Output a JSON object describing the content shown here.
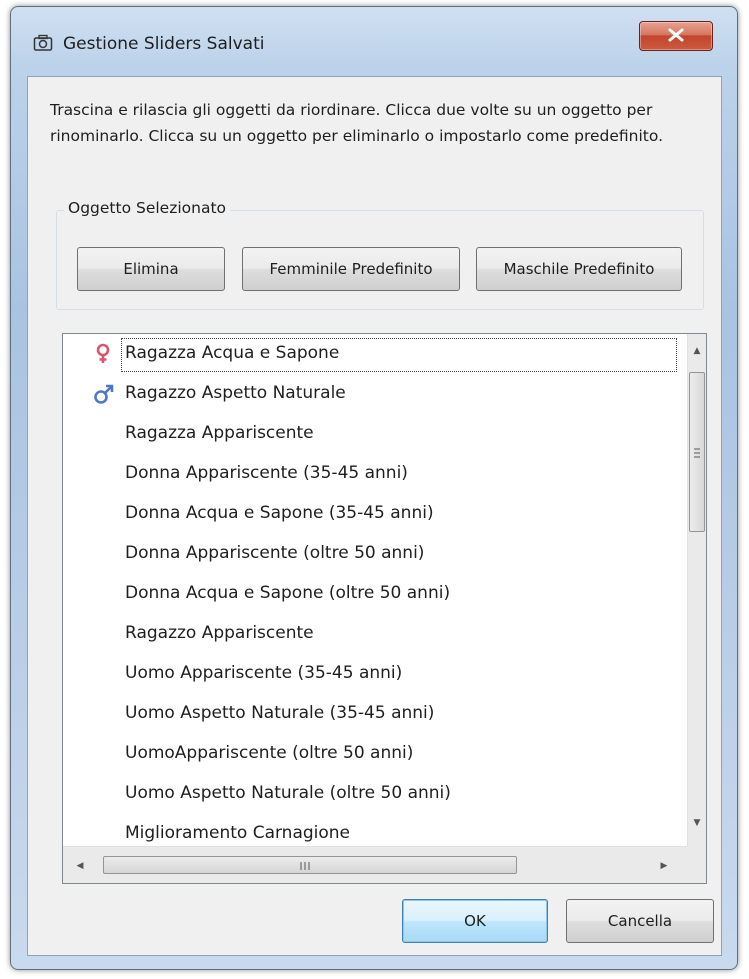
{
  "window": {
    "title": "Gestione Sliders Salvati",
    "title_icon": "camera-icon",
    "close_icon": "close-icon"
  },
  "instructions": "Trascina e rilascia gli oggetti da riordinare. Clicca due volte su un oggetto per rinominarlo. Clicca su un oggetto per eliminarlo o impostarlo come predefinito.",
  "group": {
    "legend": "Oggetto Selezionato",
    "buttons": {
      "delete": "Elimina",
      "female_default": "Femminile Predefinito",
      "male_default": "Maschile Predefinito"
    }
  },
  "list": {
    "items": [
      {
        "label": "Ragazza Acqua e Sapone",
        "icon": "female-icon"
      },
      {
        "label": "Ragazzo Aspetto Naturale",
        "icon": "male-icon"
      },
      {
        "label": "Ragazza Appariscente"
      },
      {
        "label": "Donna Appariscente (35-45 anni)"
      },
      {
        "label": "Donna Acqua e Sapone (35-45 anni)"
      },
      {
        "label": "Donna Appariscente (oltre 50 anni)"
      },
      {
        "label": "Donna Acqua e Sapone (oltre 50 anni)"
      },
      {
        "label": "Ragazzo Appariscente"
      },
      {
        "label": "Uomo Appariscente (35-45 anni)"
      },
      {
        "label": "Uomo Aspetto Naturale (35-45 anni)"
      },
      {
        "label": "UomoAppariscente (oltre 50 anni)"
      },
      {
        "label": "Uomo Aspetto Naturale (oltre 50 anni)"
      },
      {
        "label": "Miglioramento Carnagione"
      }
    ]
  },
  "footer": {
    "ok": "OK",
    "cancel": "Cancella"
  },
  "colors": {
    "female": "#d9576b",
    "male": "#4f77c8",
    "close_button": "#c7432b",
    "ok_border": "#3c7fb1"
  }
}
